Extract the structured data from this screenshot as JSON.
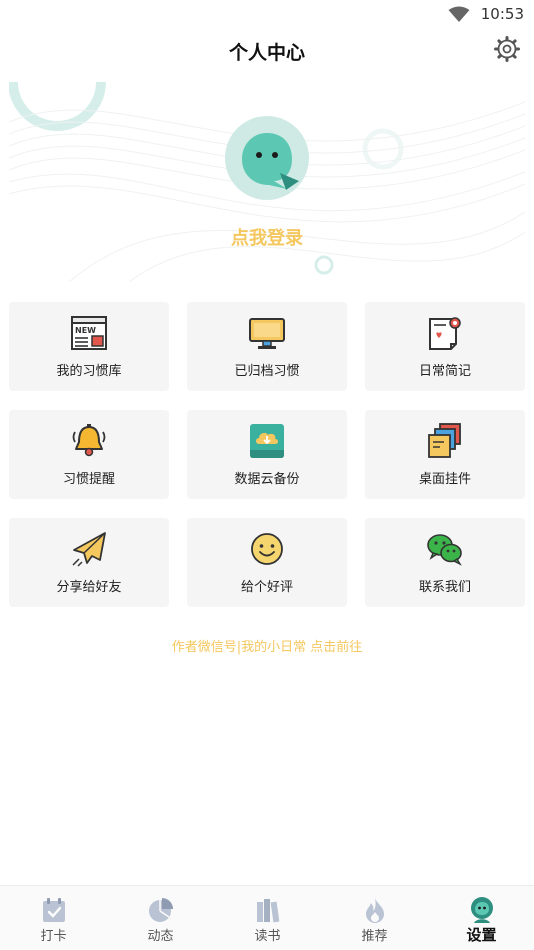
{
  "status_bar": {
    "time": "10:53"
  },
  "header": {
    "title": "个人中心",
    "settings_icon": "gear-icon"
  },
  "profile": {
    "login_label": "点我登录",
    "avatar_icon": "mascot-avatar-icon"
  },
  "menu": [
    {
      "label": "我的习惯库",
      "icon": "news-icon"
    },
    {
      "label": "已归档习惯",
      "icon": "monitor-icon"
    },
    {
      "label": "日常简记",
      "icon": "diary-note-icon"
    },
    {
      "label": "习惯提醒",
      "icon": "bell-icon"
    },
    {
      "label": "数据云备份",
      "icon": "cloud-backup-icon"
    },
    {
      "label": "桌面挂件",
      "icon": "sticky-notes-icon"
    },
    {
      "label": "分享给好友",
      "icon": "paper-plane-icon"
    },
    {
      "label": "给个好评",
      "icon": "smiley-icon"
    },
    {
      "label": "联系我们",
      "icon": "wechat-icon"
    }
  ],
  "footer": {
    "author_link": "作者微信号|我的小日常 点击前往"
  },
  "tabs": [
    {
      "label": "打卡",
      "icon": "calendar-check-icon"
    },
    {
      "label": "动态",
      "icon": "pie-chart-icon"
    },
    {
      "label": "读书",
      "icon": "books-icon"
    },
    {
      "label": "推荐",
      "icon": "flame-icon"
    },
    {
      "label": "设置",
      "icon": "profile-icon",
      "active": true
    }
  ],
  "colors": {
    "accent": "#f5c75f",
    "brand_teal": "#5cc8b4",
    "tile_bg": "#f5f5f5"
  }
}
